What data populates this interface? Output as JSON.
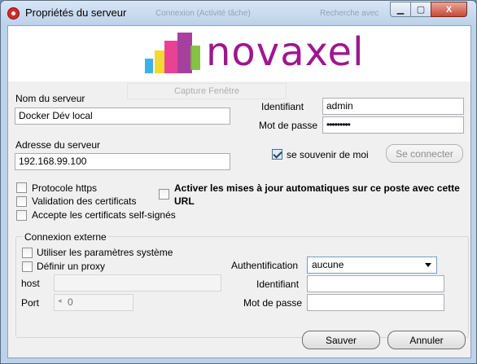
{
  "window": {
    "title": "Propriétés du serveur",
    "ghost_left": "Connexion (Activité tâche)",
    "ghost_right": "Recherche avec",
    "minimize": "▁",
    "maximize": "▢",
    "close": "X"
  },
  "logo": {
    "text": "novaxel",
    "ghost_caption": "Capture Fenêtre",
    "colors": [
      "#2aa7e0",
      "#f2d31c",
      "#e52d8a",
      "#9b2b94",
      "#79bd31"
    ]
  },
  "server": {
    "name_label": "Nom du serveur",
    "name_value": "Docker Dév local",
    "address_label": "Adresse du serveur",
    "address_value": "192.168.99.100"
  },
  "credentials": {
    "identifiant_label": "Identifiant",
    "identifiant_value": "admin",
    "password_label": "Mot de passe",
    "password_value": "•••••••••",
    "remember_label": "se souvenir de moi",
    "remember_checked": true,
    "connect_button": "Se connecter"
  },
  "options": {
    "https_label": "Protocole https",
    "validation_label": "Validation des certificats",
    "selfsigned_label": "Accepte les certificats self-signés",
    "auto_update_label_1": "Activer les mises à jour automatiques sur ce poste avec cette",
    "auto_update_label_2": "URL"
  },
  "external": {
    "group_title": "Connexion externe",
    "system_params_label": "Utiliser les paramètres système",
    "proxy_label": "Définir un proxy",
    "host_label": "host",
    "port_label": "Port",
    "port_value": "0",
    "auth_label": "Authentification",
    "auth_value": "aucune",
    "ident_label": "Identifiant",
    "password_label": "Mot de passe"
  },
  "footer": {
    "save_button": "Sauver",
    "cancel_button": "Annuler"
  }
}
